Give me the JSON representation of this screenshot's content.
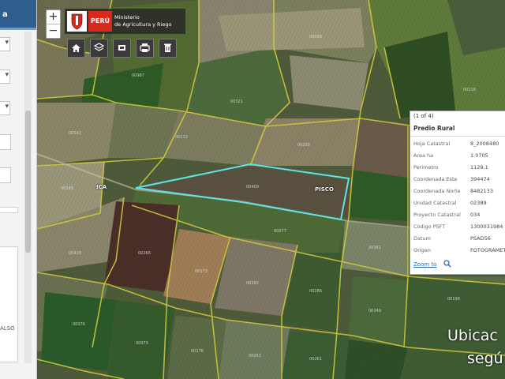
{
  "left_panel": {
    "header_label": "a",
    "box_caption": "ALSO"
  },
  "zoom": {
    "in_label": "+",
    "out_label": "−"
  },
  "ministry_header": {
    "flag_text": "PERÚ",
    "ministry_line1": "Ministerio",
    "ministry_line2": "de Agricultura y Riego"
  },
  "toolbar": {
    "icons": [
      "home-icon",
      "layers-icon",
      "map-icon",
      "print-icon",
      "trash-icon"
    ]
  },
  "popup": {
    "pager": "(1 of 4)",
    "title": "Predio Rural",
    "rows": [
      {
        "label": "Hoja Catastral",
        "value": "8_2008480"
      },
      {
        "label": "Area ha",
        "value": "1.0705"
      },
      {
        "label": "Perimetro",
        "value": "1129.1"
      },
      {
        "label": "Coordenada Este",
        "value": "394474"
      },
      {
        "label": "Coordenada Norte",
        "value": "8482133"
      },
      {
        "label": "Unidad Catastral",
        "value": "02389"
      },
      {
        "label": "Proyecto Catastral",
        "value": "034"
      },
      {
        "label": "Código PSFT",
        "value": "1300031984"
      },
      {
        "label": "Datum",
        "value": "PSAD56"
      },
      {
        "label": "Origen",
        "value": "FOTOGRAMETRIA"
      }
    ],
    "zoom_link": "Zoom to"
  },
  "map_labels": {
    "ica": "ICA",
    "pisco": "PISCO"
  },
  "overlay": {
    "line1": "Ubicac",
    "line2": "segú"
  },
  "colors": {
    "parcel_border": "#d4cc3a",
    "highlight": "#62e2e6",
    "header_blue": "#2f5e8e"
  }
}
